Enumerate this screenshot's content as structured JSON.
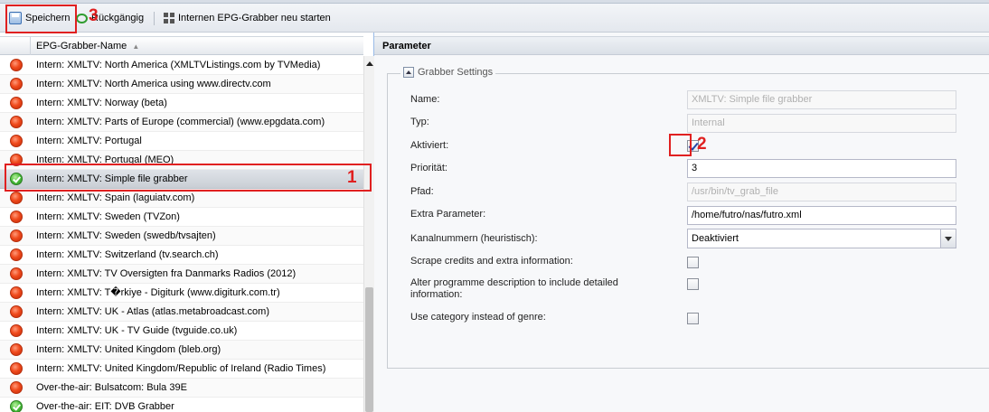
{
  "toolbar": {
    "save_label": "Speichern",
    "undo_label": "Rückgängig",
    "restart_label": "Internen EPG-Grabber neu starten"
  },
  "annotations": {
    "one": "1",
    "two": "2",
    "three": "3"
  },
  "grid": {
    "column_header": "EPG-Grabber-Name",
    "rows": [
      {
        "name": "Intern: XMLTV: North America (XMLTVListings.com by TVMedia)",
        "status": "off"
      },
      {
        "name": "Intern: XMLTV: North America using www.directv.com",
        "status": "off"
      },
      {
        "name": "Intern: XMLTV: Norway (beta)",
        "status": "off"
      },
      {
        "name": "Intern: XMLTV: Parts of Europe (commercial) (www.epgdata.com)",
        "status": "off"
      },
      {
        "name": "Intern: XMLTV: Portugal",
        "status": "off"
      },
      {
        "name": "Intern: XMLTV: Portugal (MEO)",
        "status": "off"
      },
      {
        "name": "Intern: XMLTV: Simple file grabber",
        "status": "on"
      },
      {
        "name": "Intern: XMLTV: Spain (laguiatv.com)",
        "status": "off"
      },
      {
        "name": "Intern: XMLTV: Sweden (TVZon)",
        "status": "off"
      },
      {
        "name": "Intern: XMLTV: Sweden (swedb/tvsajten)",
        "status": "off"
      },
      {
        "name": "Intern: XMLTV: Switzerland (tv.search.ch)",
        "status": "off"
      },
      {
        "name": "Intern: XMLTV: TV Oversigten fra Danmarks Radios (2012)",
        "status": "off"
      },
      {
        "name": "Intern: XMLTV: T�rkiye - Digiturk (www.digiturk.com.tr)",
        "status": "off"
      },
      {
        "name": "Intern: XMLTV: UK - Atlas (atlas.metabroadcast.com)",
        "status": "off"
      },
      {
        "name": "Intern: XMLTV: UK - TV Guide (tvguide.co.uk)",
        "status": "off"
      },
      {
        "name": "Intern: XMLTV: United Kingdom (bleb.org)",
        "status": "off"
      },
      {
        "name": "Intern: XMLTV: United Kingdom/Republic of Ireland (Radio Times)",
        "status": "off"
      },
      {
        "name": "Over-the-air: Bulsatcom: Bula 39E",
        "status": "off"
      },
      {
        "name": "Over-the-air: EIT: DVB Grabber",
        "status": "on"
      }
    ]
  },
  "params": {
    "title": "Parameter",
    "group_title": "Grabber Settings",
    "name_label": "Name:",
    "name_value": "XMLTV: Simple file grabber",
    "type_label": "Typ:",
    "type_value": "Internal",
    "enabled_label": "Aktiviert:",
    "enabled": true,
    "priority_label": "Priorität:",
    "priority_value": "3",
    "path_label": "Pfad:",
    "path_value": "/usr/bin/tv_grab_file",
    "extra_label": "Extra Parameter:",
    "extra_value": "/home/futro/nas/futro.xml",
    "channel_label": "Kanalnummern (heuristisch):",
    "channel_value": "Deaktiviert",
    "scrape_label": "Scrape credits and extra information:",
    "alter_label": "Alter programme description to include detailed information:",
    "category_label": "Use category instead of genre:"
  },
  "colors": {
    "annotation_red": "#e02020",
    "panel_border": "#99bbe8"
  }
}
